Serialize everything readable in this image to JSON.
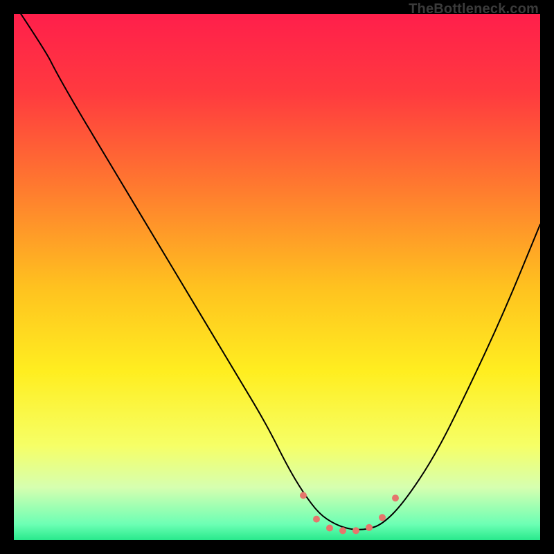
{
  "attribution": "TheBottleneck.com",
  "gradient": {
    "stops": [
      {
        "offset": 0.0,
        "color": "#ff1f4b"
      },
      {
        "offset": 0.15,
        "color": "#ff3a3f"
      },
      {
        "offset": 0.33,
        "color": "#ff7a2f"
      },
      {
        "offset": 0.52,
        "color": "#ffc21f"
      },
      {
        "offset": 0.68,
        "color": "#ffee20"
      },
      {
        "offset": 0.82,
        "color": "#f6ff66"
      },
      {
        "offset": 0.9,
        "color": "#d6ffb0"
      },
      {
        "offset": 0.97,
        "color": "#6cffb4"
      },
      {
        "offset": 1.0,
        "color": "#28e98c"
      }
    ]
  },
  "chart_data": {
    "type": "line",
    "title": "",
    "xlabel": "",
    "ylabel": "",
    "xlim": [
      0,
      100
    ],
    "ylim": [
      0,
      100
    ],
    "series": [
      {
        "name": "bottleneck-curve",
        "x": [
          0,
          6,
          8,
          12,
          18,
          24,
          30,
          36,
          42,
          48,
          52,
          55,
          58,
          61,
          64,
          67,
          70,
          74,
          80,
          86,
          93,
          100
        ],
        "y": [
          102,
          93,
          89,
          82,
          72,
          62,
          52,
          42,
          32,
          22,
          14,
          9,
          5,
          3,
          2,
          2,
          3,
          7,
          16,
          28,
          43,
          60
        ]
      }
    ],
    "markers": {
      "name": "optimal-range",
      "color": "#e5766c",
      "points": [
        {
          "x": 55.0,
          "y": 8.5,
          "r": 5
        },
        {
          "x": 57.5,
          "y": 4.0,
          "r": 5
        },
        {
          "x": 60.0,
          "y": 2.3,
          "r": 5
        },
        {
          "x": 62.5,
          "y": 1.8,
          "r": 5
        },
        {
          "x": 65.0,
          "y": 1.8,
          "r": 5
        },
        {
          "x": 67.5,
          "y": 2.4,
          "r": 5
        },
        {
          "x": 70.0,
          "y": 4.3,
          "r": 5
        },
        {
          "x": 72.5,
          "y": 8.0,
          "r": 5
        }
      ]
    }
  }
}
